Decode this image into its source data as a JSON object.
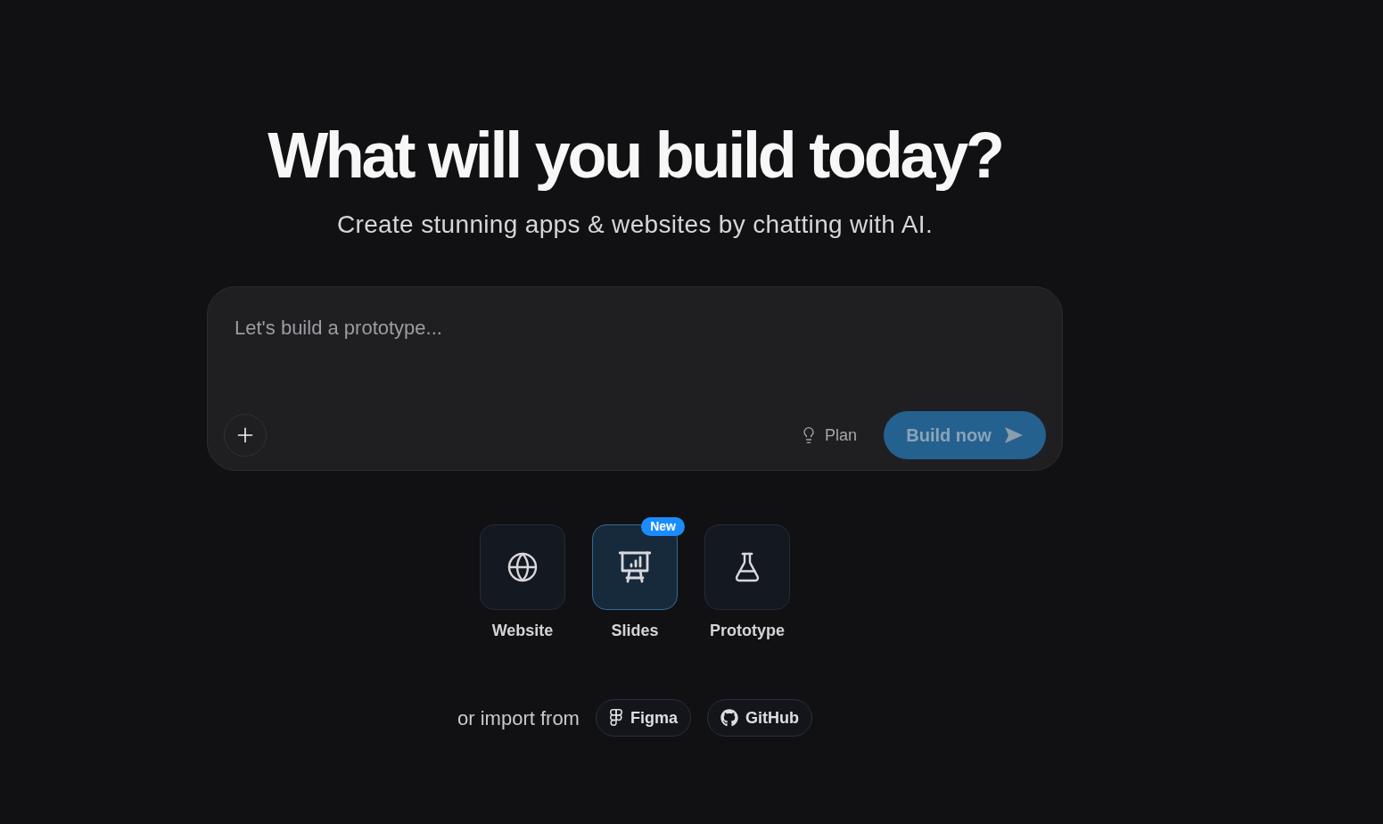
{
  "heading": "What will you build today?",
  "subtitle": "Create stunning apps & websites by chatting with AI.",
  "prompt": {
    "placeholder": "Let's build a prototype...",
    "plan_button": {
      "label": "Plan"
    },
    "submit_button": {
      "label": "Build now",
      "disabled": true
    }
  },
  "modes": [
    {
      "label": "Website",
      "selected": false
    },
    {
      "label": "Slides",
      "selected": true,
      "badge": "New"
    },
    {
      "label": "Prototype",
      "selected": false
    }
  ],
  "import": {
    "label": "or import from",
    "sources": [
      {
        "label": "Figma"
      },
      {
        "label": "GitHub"
      }
    ]
  }
}
